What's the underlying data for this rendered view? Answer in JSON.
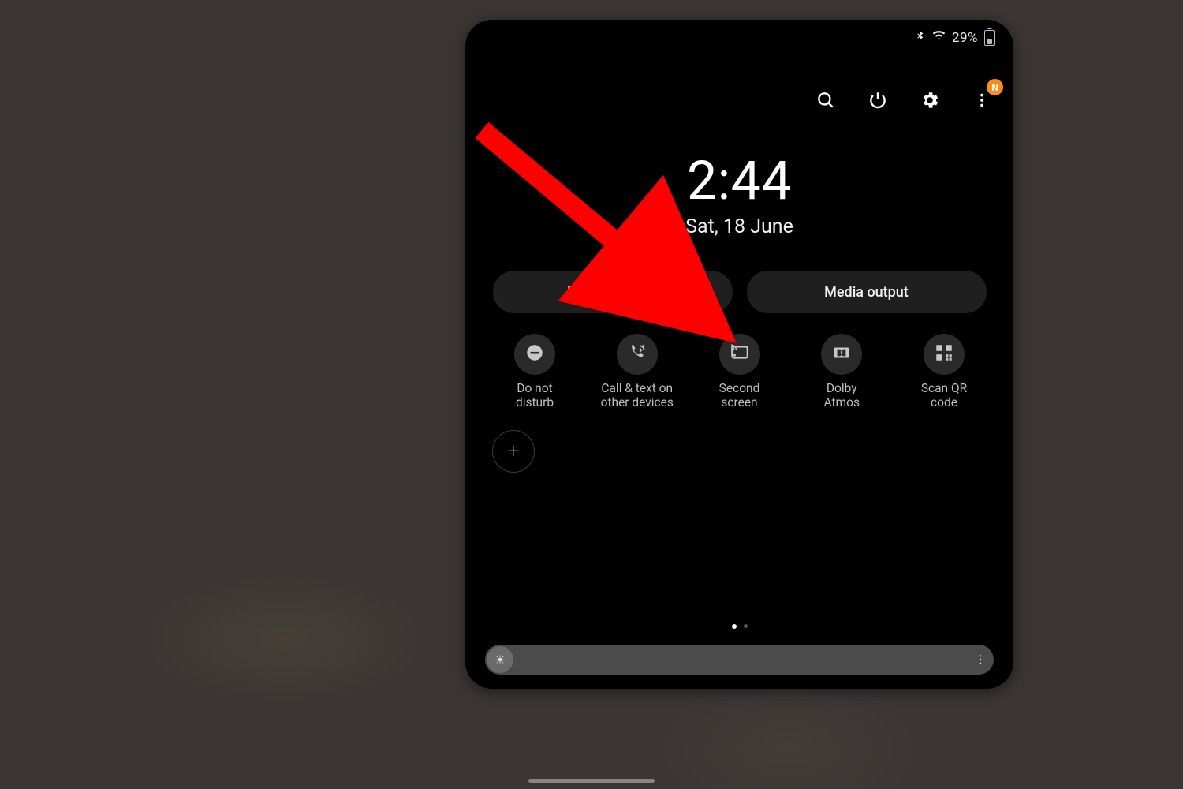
{
  "status": {
    "battery_text": "29%"
  },
  "header": {
    "notification_badge": "N"
  },
  "clock": {
    "time": "2:44",
    "date": "Sat, 18 June"
  },
  "pills": {
    "device_control": "Device control",
    "media_output": "Media output"
  },
  "tiles": [
    {
      "label": "Do not\ndisturb"
    },
    {
      "label": "Call & text on\nother devices"
    },
    {
      "label": "Second\nscreen"
    },
    {
      "label": "Dolby\nAtmos"
    },
    {
      "label": "Scan QR\ncode"
    }
  ],
  "annotation": {
    "target": "second-screen"
  }
}
